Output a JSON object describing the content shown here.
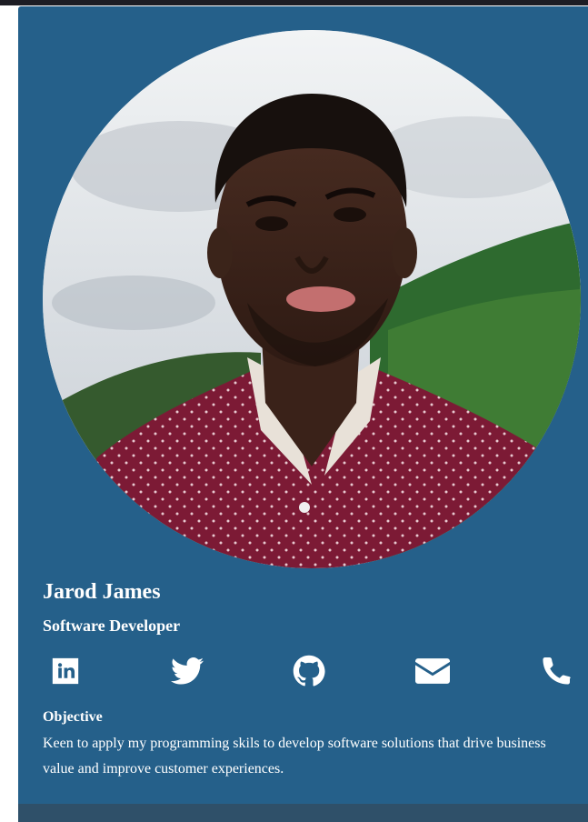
{
  "profile": {
    "name": "Jarod James",
    "title": "Software Developer",
    "photo_alt": "Jarod James"
  },
  "social": [
    {
      "icon": "linkedin-icon"
    },
    {
      "icon": "twitter-icon"
    },
    {
      "icon": "github-icon"
    },
    {
      "icon": "mail-icon"
    },
    {
      "icon": "phone-icon"
    }
  ],
  "objective": {
    "heading": "Objective",
    "text": "Keen to apply my programming skils to develop software solutions that drive business value and improve customer experiences."
  },
  "colors": {
    "card_background": "#25608a",
    "bottom_band": "#2f5069",
    "top_bar": "#1d1d24",
    "text": "#ffffff"
  }
}
